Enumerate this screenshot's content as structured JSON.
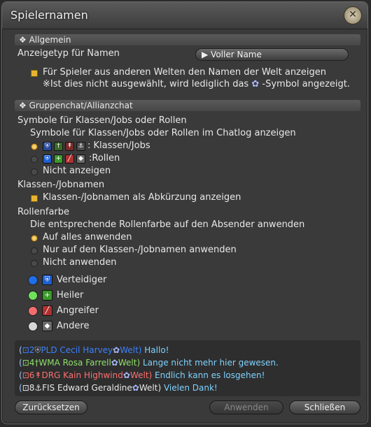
{
  "window": {
    "title": "Spielernamen"
  },
  "sections": {
    "general": "Allgemein",
    "party": "Gruppenchat/Allianzchat"
  },
  "general": {
    "display_type_label": "Anzeigetyp für Namen",
    "display_type_value": "Voller Name",
    "world_checkbox_label": "Für Spieler aus anderen Welten den Namen der Welt anzeigen",
    "world_note": "※Ist dies nicht ausgewählt, wird lediglich das",
    "world_note_suffix": "-Symbol angezeigt."
  },
  "symbols": {
    "heading": "Symbole für Klassen/Jobs oder Rollen",
    "subheading": "Symbole für Klassen/Jobs oder Rollen im Chatlog anzeigen",
    "options": [
      {
        "label": ": Klassen/Jobs",
        "selected": true
      },
      {
        "label": ":Rollen",
        "selected": false
      },
      {
        "label": "Nicht anzeigen",
        "selected": false
      }
    ]
  },
  "jobnames": {
    "heading": "Klassen-/Jobnamen",
    "checkbox_label": "Klassen-/Jobnamen als Abkürzung anzeigen"
  },
  "rolecolor": {
    "heading": "Rollenfarbe",
    "subheading": "Die entsprechende Rollenfarbe auf den Absender anwenden",
    "options": [
      {
        "label": "Auf alles anwenden",
        "selected": true
      },
      {
        "label": "Nur auf den Klassen-/Jobnamen anwenden",
        "selected": false
      },
      {
        "label": "Nicht anwenden",
        "selected": false
      }
    ],
    "roles": [
      {
        "label": "Verteidiger",
        "color": "#1e6fe8"
      },
      {
        "label": "Heiler",
        "color": "#6fe05a"
      },
      {
        "label": "Angreifer",
        "color": "#f26d6d"
      },
      {
        "label": "Andere",
        "color": "#d6d6d6"
      }
    ]
  },
  "chat_preview": [
    {
      "num": "2",
      "name": "PLD Cecil Harvey",
      "world": "Welt)",
      "message": "Hallo!",
      "name_color": "#3a82ff",
      "msg_color": "#7fd3ff"
    },
    {
      "num": "4",
      "name": "WMA Rosa Farrell",
      "world": "Welt)",
      "message": "Lange nicht mehr hier gewesen.",
      "name_color": "#8fe06a",
      "msg_color": "#7fd3ff"
    },
    {
      "num": "6",
      "name": "DRG Kain Highwind",
      "world": "Welt)",
      "message": "Endlich kann es losgehen!",
      "name_color": "#ff6f6f",
      "msg_color": "#7fd3ff"
    },
    {
      "num": "8",
      "name": "FIS Edward Geraldine",
      "world": "Welt)",
      "message": "Vielen Dank!",
      "name_color": "#e8e8e8",
      "msg_color": "#7fd3ff"
    }
  ],
  "buttons": {
    "reset": "Zurücksetzen",
    "apply": "Anwenden",
    "close": "Schließen"
  }
}
